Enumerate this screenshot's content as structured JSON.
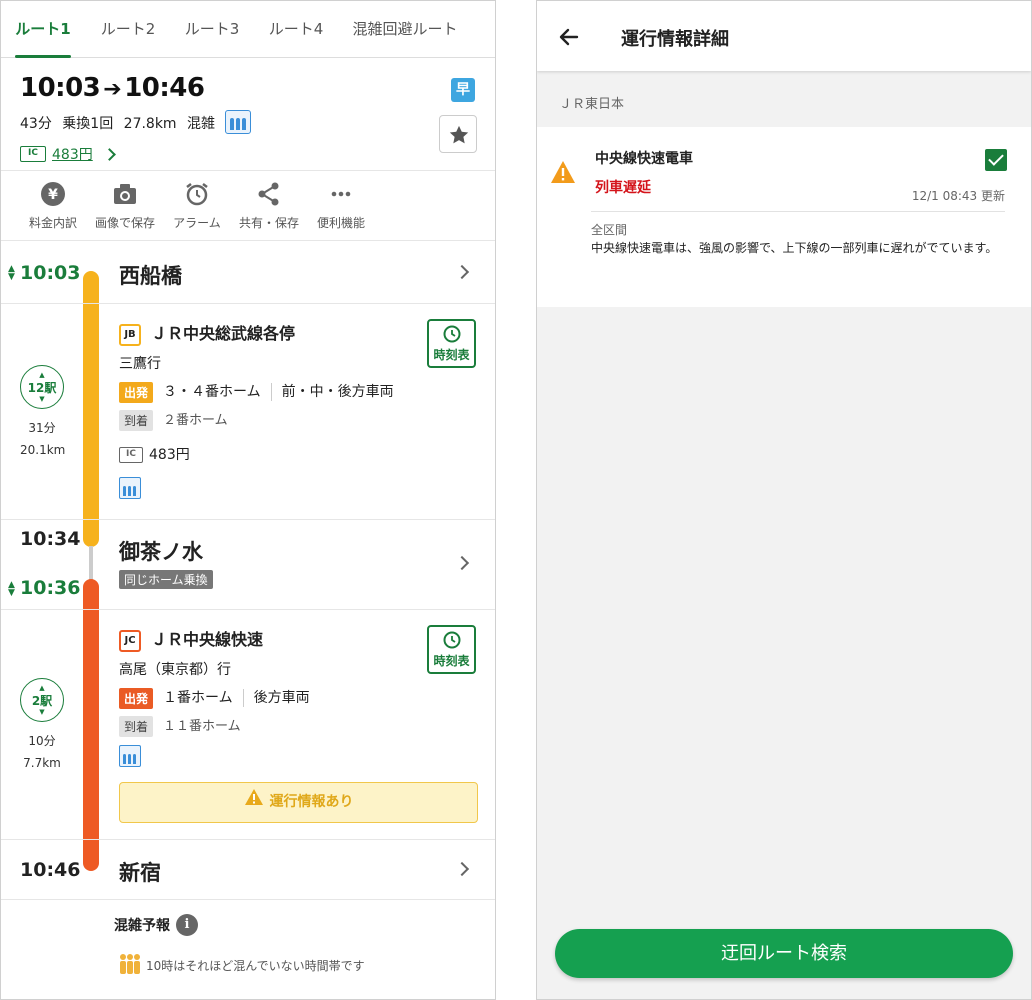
{
  "tabs": [
    "ルート1",
    "ルート2",
    "ルート3",
    "ルート4",
    "混雑回避ルート"
  ],
  "summary": {
    "dep_time": "10:03",
    "arr_time": "10:46",
    "duration": "43分",
    "transfers": "乗換1回",
    "distance": "27.8km",
    "crowd_label": "混雑",
    "fast_badge": "早",
    "ic_label": "IC",
    "fare": "483円"
  },
  "tools": [
    {
      "label": "料金内訳",
      "icon": "yen-icon"
    },
    {
      "label": "画像で保存",
      "icon": "camera-icon"
    },
    {
      "label": "アラーム",
      "icon": "alarm-icon"
    },
    {
      "label": "共有・保存",
      "icon": "share-icon"
    },
    {
      "label": "便利機能",
      "icon": "more-icon"
    }
  ],
  "route": {
    "start": {
      "time": "10:03",
      "station": "西船橋"
    },
    "seg1": {
      "badge": "JB",
      "line": "ＪＲ中央総武線各停",
      "dest": "三鷹行",
      "dep_tag": "出発",
      "dep_platform": "３・４番ホーム",
      "car_pos": "前・中・後方車両",
      "arr_tag": "到着",
      "arr_platform": "２番ホーム",
      "stops": "12駅",
      "minutes": "31分",
      "distance": "20.1km",
      "ic_label": "IC",
      "fare": "483円",
      "timetable": "時刻表",
      "color": "#f6b21d"
    },
    "transfer": {
      "arr_time": "10:34",
      "dep_time": "10:36",
      "station": "御茶ノ水",
      "note": "同じホーム乗換"
    },
    "seg2": {
      "badge": "JC",
      "line": "ＪＲ中央線快速",
      "dest": "高尾（東京都）行",
      "dep_tag": "出発",
      "dep_platform": "１番ホーム",
      "car_pos": "後方車両",
      "arr_tag": "到着",
      "arr_platform": "１１番ホーム",
      "stops": "2駅",
      "minutes": "10分",
      "distance": "7.7km",
      "timetable": "時刻表",
      "alert": "運行情報あり",
      "color": "#ee5a24"
    },
    "end": {
      "time": "10:46",
      "station": "新宿"
    },
    "forecast_title": "混雑予報",
    "forecast_info_icon": "i",
    "forecast_text": "10時はそれほど混んでいない時間帯です"
  },
  "detail": {
    "title": "運行情報詳細",
    "company": "ＪＲ東日本",
    "line": "中央線快速電車",
    "status": "列車遅延",
    "updated": "12/1 08:43 更新",
    "section": "全区間",
    "description": "中央線快速電車は、強風の影響で、上下線の一部列車に遅れがでています。",
    "detour_button": "迂回ルート検索"
  },
  "colors": {
    "accent": "#1a7d3b",
    "button": "#15a050",
    "delay": "#d4141b"
  }
}
